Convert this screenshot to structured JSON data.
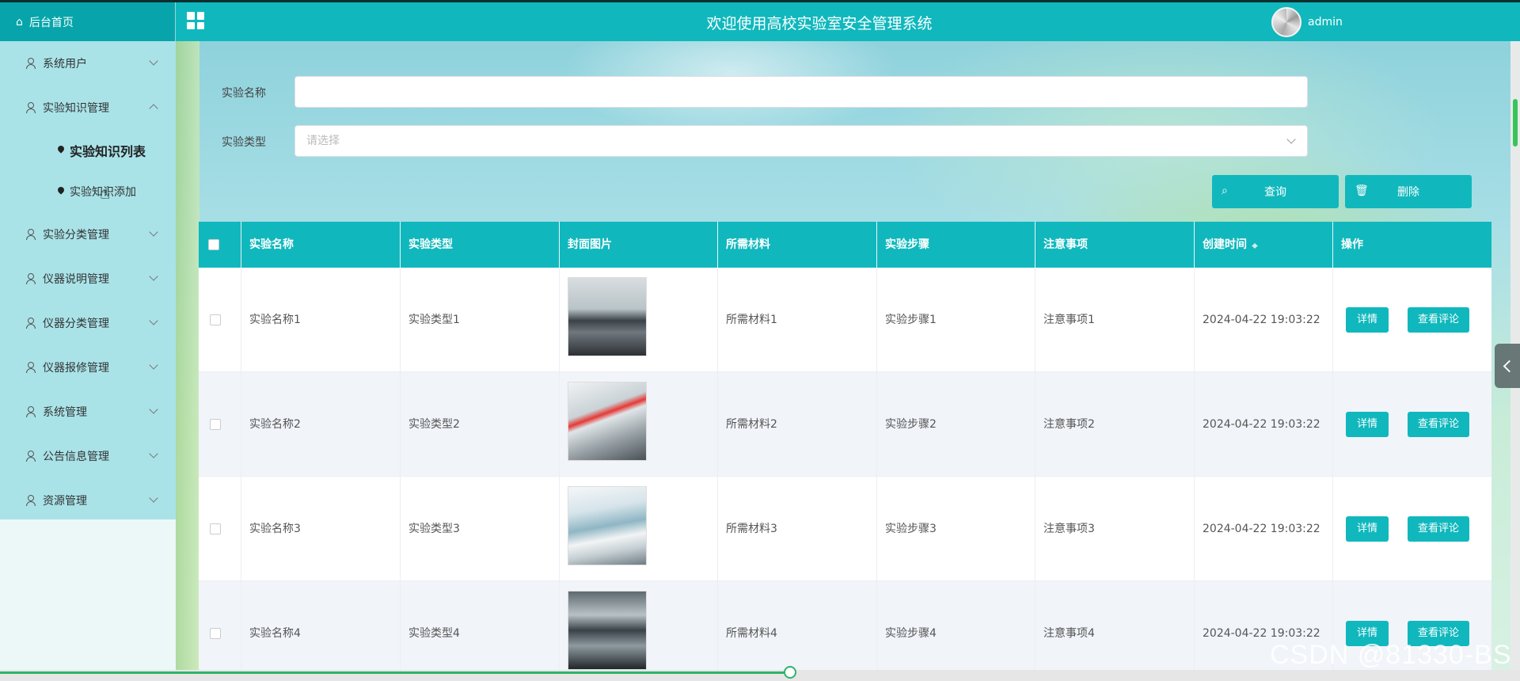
{
  "header": {
    "home_label": "后台首页",
    "title": "欢迎使用高校实验室安全管理系统",
    "username": "admin"
  },
  "sidebar": {
    "items": [
      {
        "label": "系统用户",
        "expanded": false
      },
      {
        "label": "实验知识管理",
        "expanded": true
      },
      {
        "label": "实验分类管理",
        "expanded": false
      },
      {
        "label": "仪器说明管理",
        "expanded": false
      },
      {
        "label": "仪器分类管理",
        "expanded": false
      },
      {
        "label": "仪器报修管理",
        "expanded": false
      },
      {
        "label": "系统管理",
        "expanded": false
      },
      {
        "label": "公告信息管理",
        "expanded": false
      },
      {
        "label": "资源管理",
        "expanded": false
      }
    ],
    "sub_items": [
      {
        "label": "实验知识列表",
        "active": true
      },
      {
        "label": "实验知识添加",
        "active": false
      }
    ]
  },
  "search": {
    "name_label": "实验名称",
    "name_value": "",
    "type_label": "实验类型",
    "type_placeholder": "请选择",
    "query_button": "查询",
    "delete_button": "删除"
  },
  "table": {
    "columns": [
      "实验名称",
      "实验类型",
      "封面图片",
      "所需材料",
      "实验步骤",
      "注意事项",
      "创建时间",
      "操作"
    ],
    "rows": [
      {
        "name": "实验名称1",
        "type": "实验类型1",
        "materials": "所需材料1",
        "steps": "实验步骤1",
        "notes": "注意事项1",
        "created": "2024-04-22 19:03:22"
      },
      {
        "name": "实验名称2",
        "type": "实验类型2",
        "materials": "所需材料2",
        "steps": "实验步骤2",
        "notes": "注意事项2",
        "created": "2024-04-22 19:03:22"
      },
      {
        "name": "实验名称3",
        "type": "实验类型3",
        "materials": "所需材料3",
        "steps": "实验步骤3",
        "notes": "注意事项3",
        "created": "2024-04-22 19:03:22"
      },
      {
        "name": "实验名称4",
        "type": "实验类型4",
        "materials": "所需材料4",
        "steps": "实验步骤4",
        "notes": "注意事项4",
        "created": "2024-04-22 19:03:22"
      }
    ],
    "detail_button": "详情",
    "comments_button": "查看评论"
  },
  "video_progress": 0.52,
  "watermark": "CSDN @81330-BS",
  "colors": {
    "accent": "#10b8bd",
    "progress": "#2fb36a"
  }
}
